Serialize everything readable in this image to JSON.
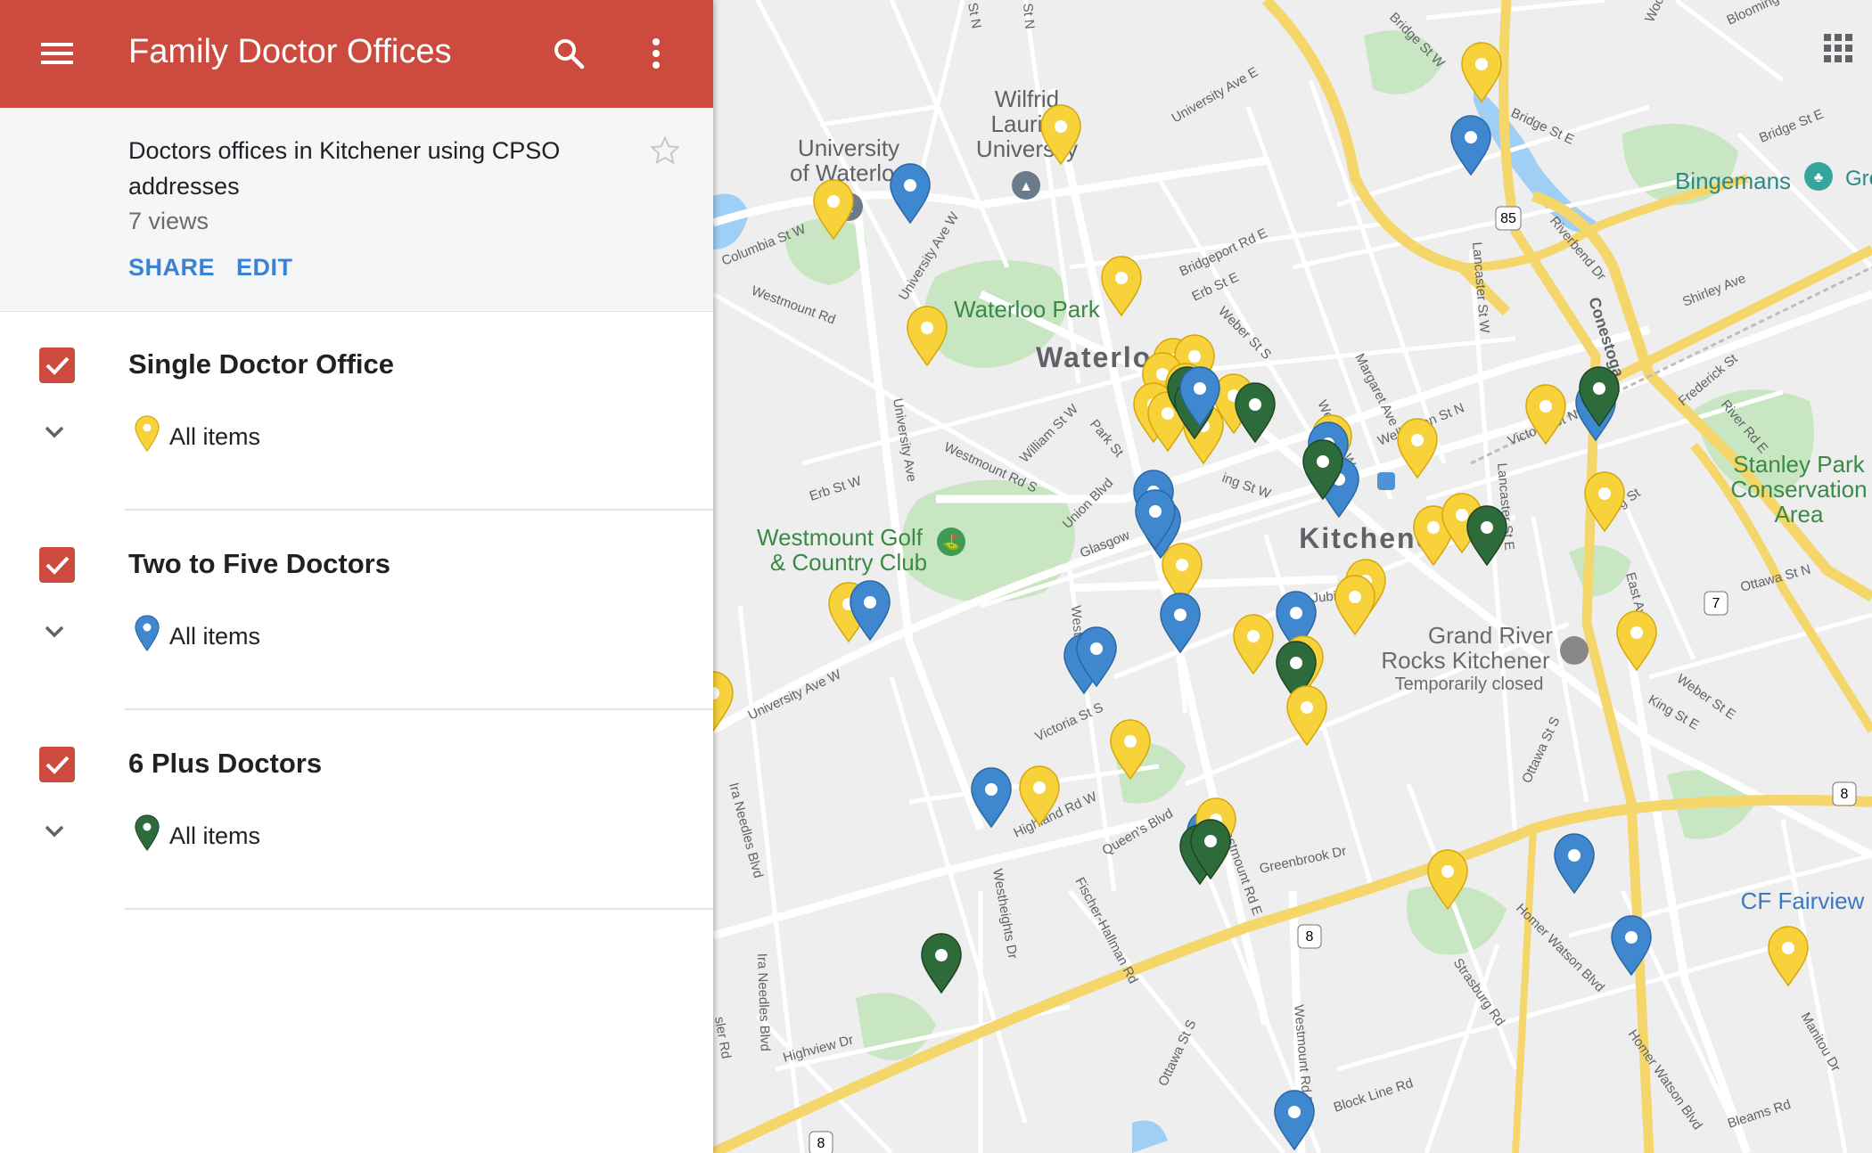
{
  "header": {
    "title": "Family Doctor Offices",
    "menu_icon": "hamburger-menu-icon",
    "search_icon": "search-icon",
    "more_icon": "more-vert-icon",
    "color": "#cc4b3e"
  },
  "map_info": {
    "description": "Doctors offices in Kitchener using CPSO addresses",
    "views": "7 views",
    "share_label": "SHARE",
    "edit_label": "EDIT"
  },
  "layers": [
    {
      "title": "Single Doctor Office",
      "item_label": "All items",
      "color": "#f7d23b",
      "checked": true
    },
    {
      "title": "Two to Five Doctors",
      "item_label": "All items",
      "color": "#3f88cf",
      "checked": true
    },
    {
      "title": "6 Plus Doctors",
      "item_label": "All items",
      "color": "#2e6b3a",
      "checked": true
    }
  ],
  "map": {
    "labels": {
      "waterloo": "Waterloo",
      "kitchener": "Kitchener",
      "uw1": "University",
      "uw2": "of Waterloo",
      "wlu1": "Wilfrid",
      "wlu2": "Laurier",
      "wlu3": "University",
      "waterloo_park": "Waterloo Park",
      "golf1": "Westmount Golf",
      "golf2": "& Country Club",
      "grand1": "Grand River",
      "grand2": "Rocks Kitchener",
      "closed": "Temporarily closed",
      "bingemans": "Bingemans",
      "stanley1": "Stanley Park",
      "stanley2": "Conservation",
      "stanley3": "Area",
      "fairview": "CF Fairview",
      "gre": "Gre"
    },
    "roads": {
      "columbia": "Columbia St W",
      "westmount_rd": "Westmount Rd",
      "university_ave_w": "University Ave W",
      "university_ave_w2": "University Ave W",
      "university_ave_e": "University Ave E",
      "bridgeport": "Bridgeport Rd E",
      "erb_e": "Erb St E",
      "weber_s": "Weber St S",
      "margaret": "Margaret Ave",
      "weber_w": "Weber St W",
      "wellington": "Wellington St N",
      "victoria_n": "Victoria St N",
      "lancaster": "Lancaster St W",
      "lancaster_e": "Lancaster St E",
      "bridge_w": "Bridge St W",
      "bridge_e": "Bridge St E",
      "bridge_e2": "Bridge St E",
      "riverbend": "Riverbend Dr",
      "conestoga": "Conestoga",
      "shirley": "Shirley Ave",
      "frederick": "Frederick St",
      "river_rd": "River Rd E",
      "krug": "Krug St",
      "east_ave": "East Ave",
      "ottawa_n": "Ottawa St N",
      "weber_e": "Weber St E",
      "king_e": "King St E",
      "ottawa_s": "Ottawa St S",
      "ottawa_s2": "Ottawa St S",
      "erb_w": "Erb St W",
      "westmount_s": "Westmount Rd S",
      "william": "William St W",
      "park": "Park St",
      "union": "Union Blvd",
      "glasgow": "Glasgow",
      "university_ave": "University Ave W",
      "jubilee": "Jubilee",
      "victoria_s": "Victoria St S",
      "westmount": "Westmount",
      "highland": "Highland Rd W",
      "queens": "Queen's Blvd",
      "westheights": "Westheights Dr",
      "fischer": "Fischer-Hallman Rd",
      "westmount_e": "Westmount Rd E",
      "westmount_e2": "Westmount Rd E",
      "greenbrook": "Greenbrook Dr",
      "strasburg": "Strasburg Rd",
      "homer": "Homer Watson Blvd",
      "homer2": "Homer Watson Blvd",
      "manitou": "Manitou Dr",
      "block_line": "Block Line Rd",
      "bleams": "Bleams Rd",
      "highview": "Highview Dr",
      "ira1": "Ira Needles Blvd",
      "ira2": "Ira Needles Blvd",
      "fisher": "sler Rd",
      "king_w": "ing St W",
      "university_n": "University Ave",
      "st_n1": "St N",
      "st_n2": "St N",
      "blooming": "Blooming",
      "wool": "Wool"
    },
    "shields": {
      "hwy85": "85",
      "hwy7": "7",
      "hwy8a": "8",
      "hwy8b": "8",
      "hwy8c": "8"
    }
  }
}
